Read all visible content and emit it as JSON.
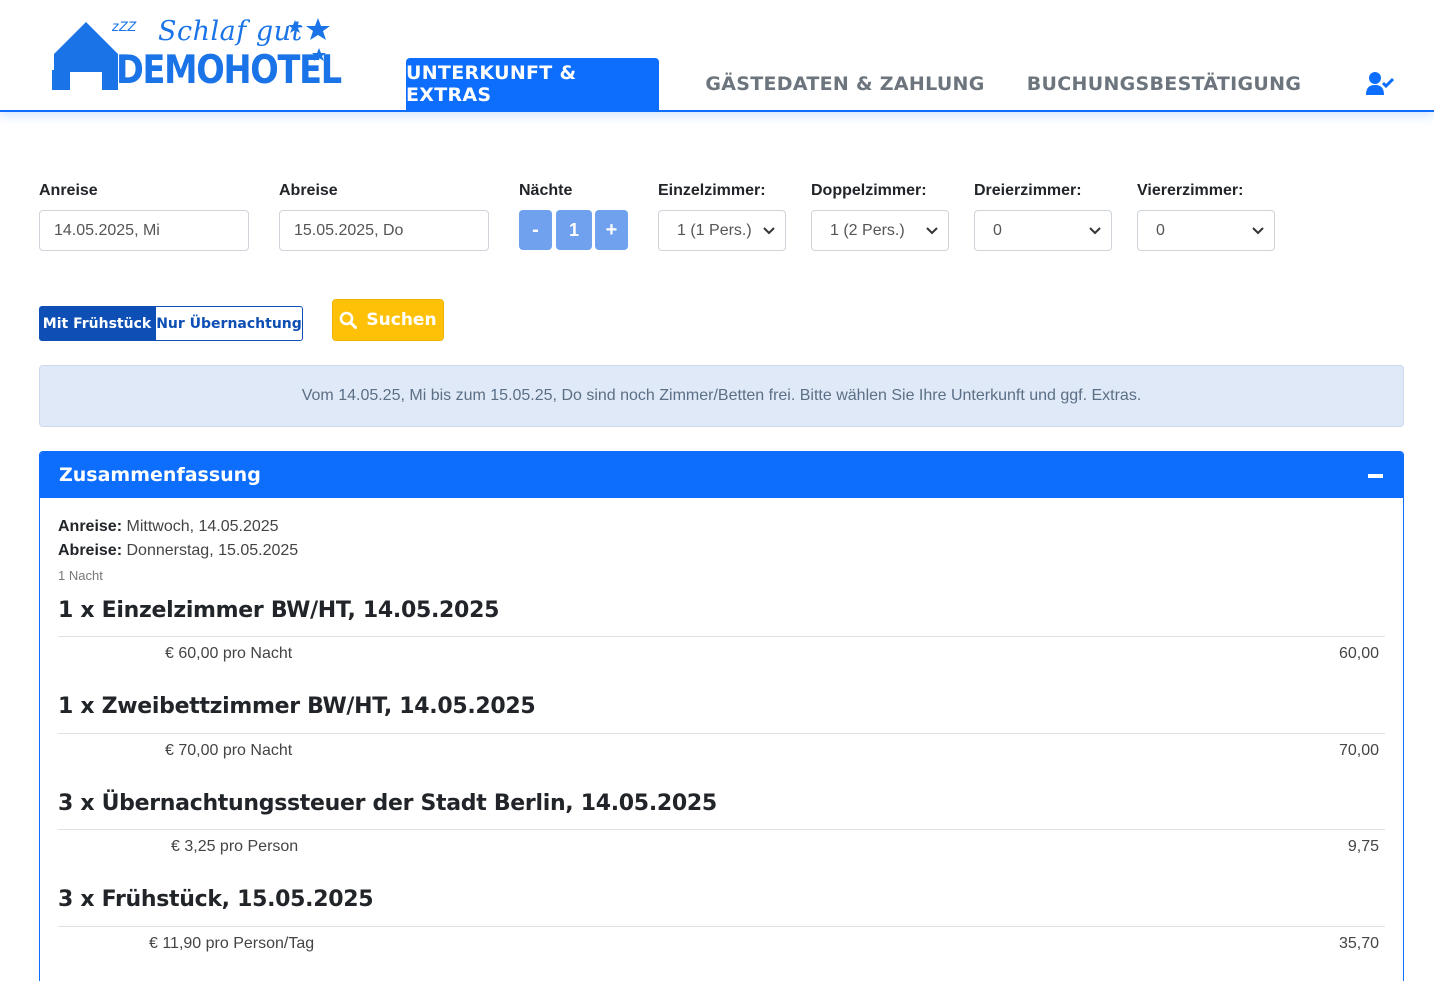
{
  "logo": {
    "script": "Schlaf gut",
    "zzz": "zZZ",
    "word": "DEMOHOTEL"
  },
  "nav": {
    "tab1": "UNTERKUNFT & EXTRAS",
    "tab2": "GÄSTEDATEN & ZAHLUNG",
    "tab3": "BUCHUNGSBESTÄTIGUNG"
  },
  "form": {
    "arrival_label": "Anreise",
    "arrival_value": "14.05.2025, Mi",
    "departure_label": "Abreise",
    "departure_value": "15.05.2025, Do",
    "nights_label": "Nächte",
    "nights_minus": "-",
    "nights_value": "1",
    "nights_plus": "+",
    "single_label": "Einzelzimmer:",
    "single_value": "1 (1 Pers.)",
    "double_label": "Doppelzimmer:",
    "double_value": "1 (2 Pers.)",
    "triple_label": "Dreierzimmer:",
    "triple_value": "0",
    "quad_label": "Viererzimmer:",
    "quad_value": "0"
  },
  "options": {
    "with_breakfast": "Mit Frühstück",
    "only_overnight": "Nur Übernachtung",
    "search": "Suchen"
  },
  "info": "Vom 14.05.25, Mi bis zum 15.05.25, Do sind noch Zimmer/Betten frei. Bitte wählen Sie Ihre Unterkunft und ggf. Extras.",
  "summary": {
    "title": "Zusammenfassung",
    "arrival_label": "Anreise:",
    "arrival_value": "Mittwoch, 14.05.2025",
    "departure_label": "Abreise:",
    "departure_value": "Donnerstag, 15.05.2025",
    "nights": "1 Nacht",
    "items": [
      {
        "title": "1 x Einzelzimmer BW/HT, 14.05.2025",
        "price": "€ 60,00 pro Nacht",
        "amount": "60,00"
      },
      {
        "title": "1 x Zweibettzimmer BW/HT, 14.05.2025",
        "price": "€ 70,00 pro Nacht",
        "amount": "70,00"
      },
      {
        "title": "3 x Übernachtungssteuer der Stadt Berlin, 14.05.2025",
        "price": "€ 3,25 pro Person",
        "amount": "9,75"
      },
      {
        "title": "3 x Frühstück, 15.05.2025",
        "price": "€ 11,90 pro Person/Tag",
        "amount": "35,70"
      }
    ]
  }
}
